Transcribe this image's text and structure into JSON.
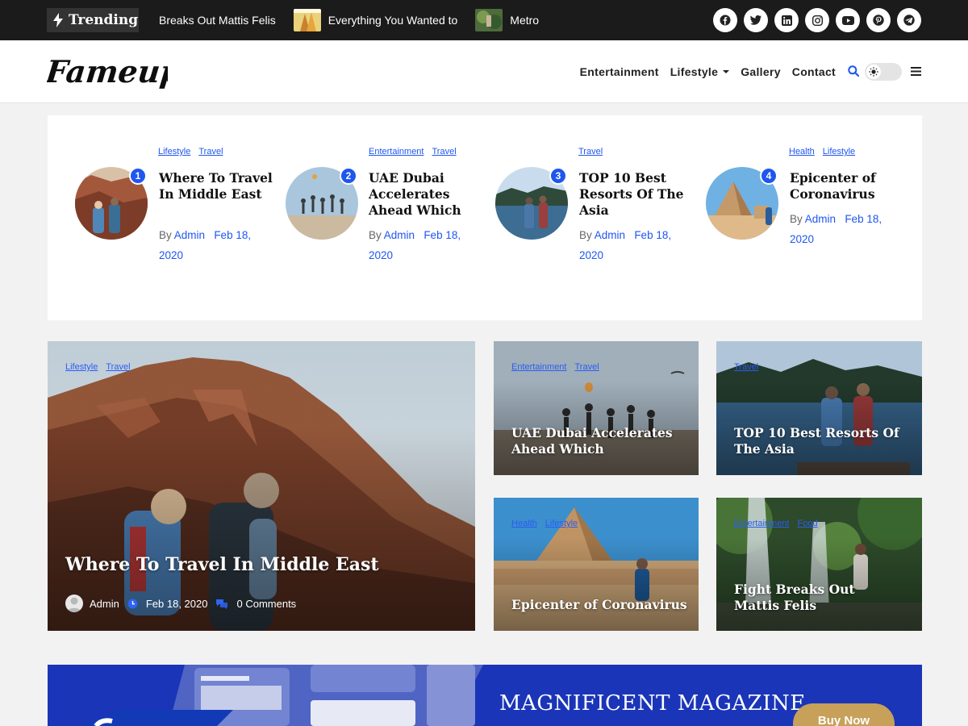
{
  "topbar": {
    "trending_label": "Trending",
    "ticker": [
      {
        "text": "Breaks Out Mattis Felis",
        "thumb": false
      },
      {
        "text": "Everything You Wanted to",
        "thumb": true
      },
      {
        "text": "Metro",
        "thumb": true
      }
    ],
    "socials": [
      "facebook-icon",
      "twitter-icon",
      "linkedin-icon",
      "instagram-icon",
      "youtube-icon",
      "pinterest-icon",
      "telegram-icon"
    ]
  },
  "header": {
    "logo_text": "Fameup",
    "nav": [
      "Entertainment",
      "Lifestyle",
      "Gallery",
      "Contact"
    ]
  },
  "featured": [
    {
      "num": "1",
      "cats": [
        "Lifestyle",
        "Travel"
      ],
      "title": "Where To Travel In Middle East",
      "by": "By",
      "author": "Admin",
      "date": "Feb 18, 2020"
    },
    {
      "num": "2",
      "cats": [
        "Entertainment",
        "Travel"
      ],
      "title": "UAE Dubai Accelerates Ahead Which",
      "by": "By",
      "author": "Admin",
      "date": "Feb 18, 2020"
    },
    {
      "num": "3",
      "cats": [
        "Travel"
      ],
      "title": "TOP 10 Best Resorts Of The Asia",
      "by": "By",
      "author": "Admin",
      "date": "Feb 18, 2020"
    },
    {
      "num": "4",
      "cats": [
        "Health",
        "Lifestyle"
      ],
      "title": "Epicenter of Coronavirus",
      "by": "By",
      "author": "Admin",
      "date": "Feb 18, 2020"
    }
  ],
  "big_card": {
    "cats": [
      "Lifestyle",
      "Travel"
    ],
    "title": "Where To Travel In Middle East",
    "author": "Admin",
    "date": "Feb 18, 2020",
    "comments": "0 Comments"
  },
  "cards": [
    {
      "cats": [
        "Entertainment",
        "Travel"
      ],
      "title": "UAE Dubai Accelerates Ahead Which"
    },
    {
      "cats": [
        "Travel"
      ],
      "title": "TOP 10 Best Resorts Of The Asia"
    },
    {
      "cats": [
        "Health",
        "Lifestyle"
      ],
      "title": "Epicenter of Coronavirus"
    },
    {
      "cats": [
        "Entertainment",
        "Food"
      ],
      "title": "Fight Breaks Out Mattis Felis"
    }
  ],
  "banner": {
    "title": "MAGNIFICENT MAGAZINE",
    "button": "Buy Now"
  },
  "colors": {
    "accent": "#1f56f0",
    "topbar": "#1b1b1b",
    "banner": "#1a35b8",
    "button": "#c7a05a"
  }
}
